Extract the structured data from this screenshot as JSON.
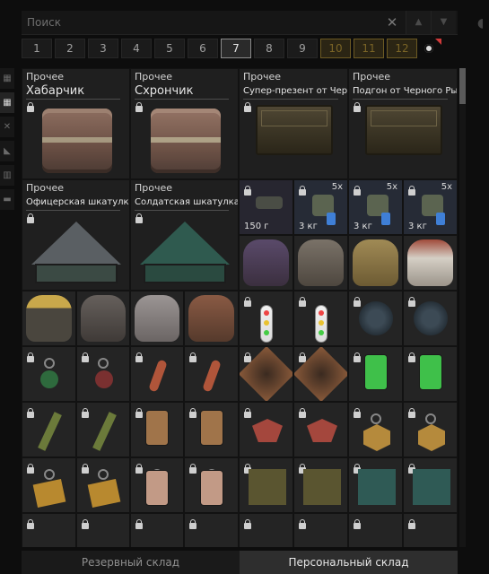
{
  "search": {
    "placeholder": "Поиск",
    "clear_icon": "close-icon",
    "up_icon": "▲",
    "down_icon": "▼"
  },
  "pages": [
    "1",
    "2",
    "3",
    "4",
    "5",
    "6",
    "7",
    "8",
    "9",
    "10",
    "11",
    "12"
  ],
  "active_page": "7",
  "locked_pages": [
    "10",
    "11",
    "12"
  ],
  "sidebar": [
    "grid-small-icon",
    "grid-large-icon",
    "tools-icon",
    "wedge-icon",
    "panel-icon",
    "box-icon"
  ],
  "items_big": [
    {
      "cat": "Прочее",
      "name": "Хабарчик",
      "art": "can"
    },
    {
      "cat": "Прочее",
      "name": "Схрончик",
      "art": "can"
    },
    {
      "cat": "Прочее",
      "name": "Супер-презент от Черно...",
      "art": "chest"
    },
    {
      "cat": "Прочее",
      "name": "Подгон от Черного Рын...",
      "art": "chest"
    },
    {
      "cat": "Прочее",
      "name": "Офицерская шкатулка",
      "art": "pyramid-grey"
    },
    {
      "cat": "Прочее",
      "name": "Солдатская шкатулка",
      "art": "pyramid-green"
    }
  ],
  "row2_small": [
    {
      "weight": "150 г",
      "count": ""
    },
    {
      "weight": "3 кг",
      "count": "5x"
    },
    {
      "weight": "3 кг",
      "count": "5x"
    },
    {
      "weight": "3 кг",
      "count": "5x"
    }
  ],
  "bottom_tabs": {
    "reserve": "Резервный склад",
    "personal": "Персональный склад"
  },
  "colors": {
    "accent_locked": "#6c5a23",
    "active_tab": "#2e2e2e"
  }
}
